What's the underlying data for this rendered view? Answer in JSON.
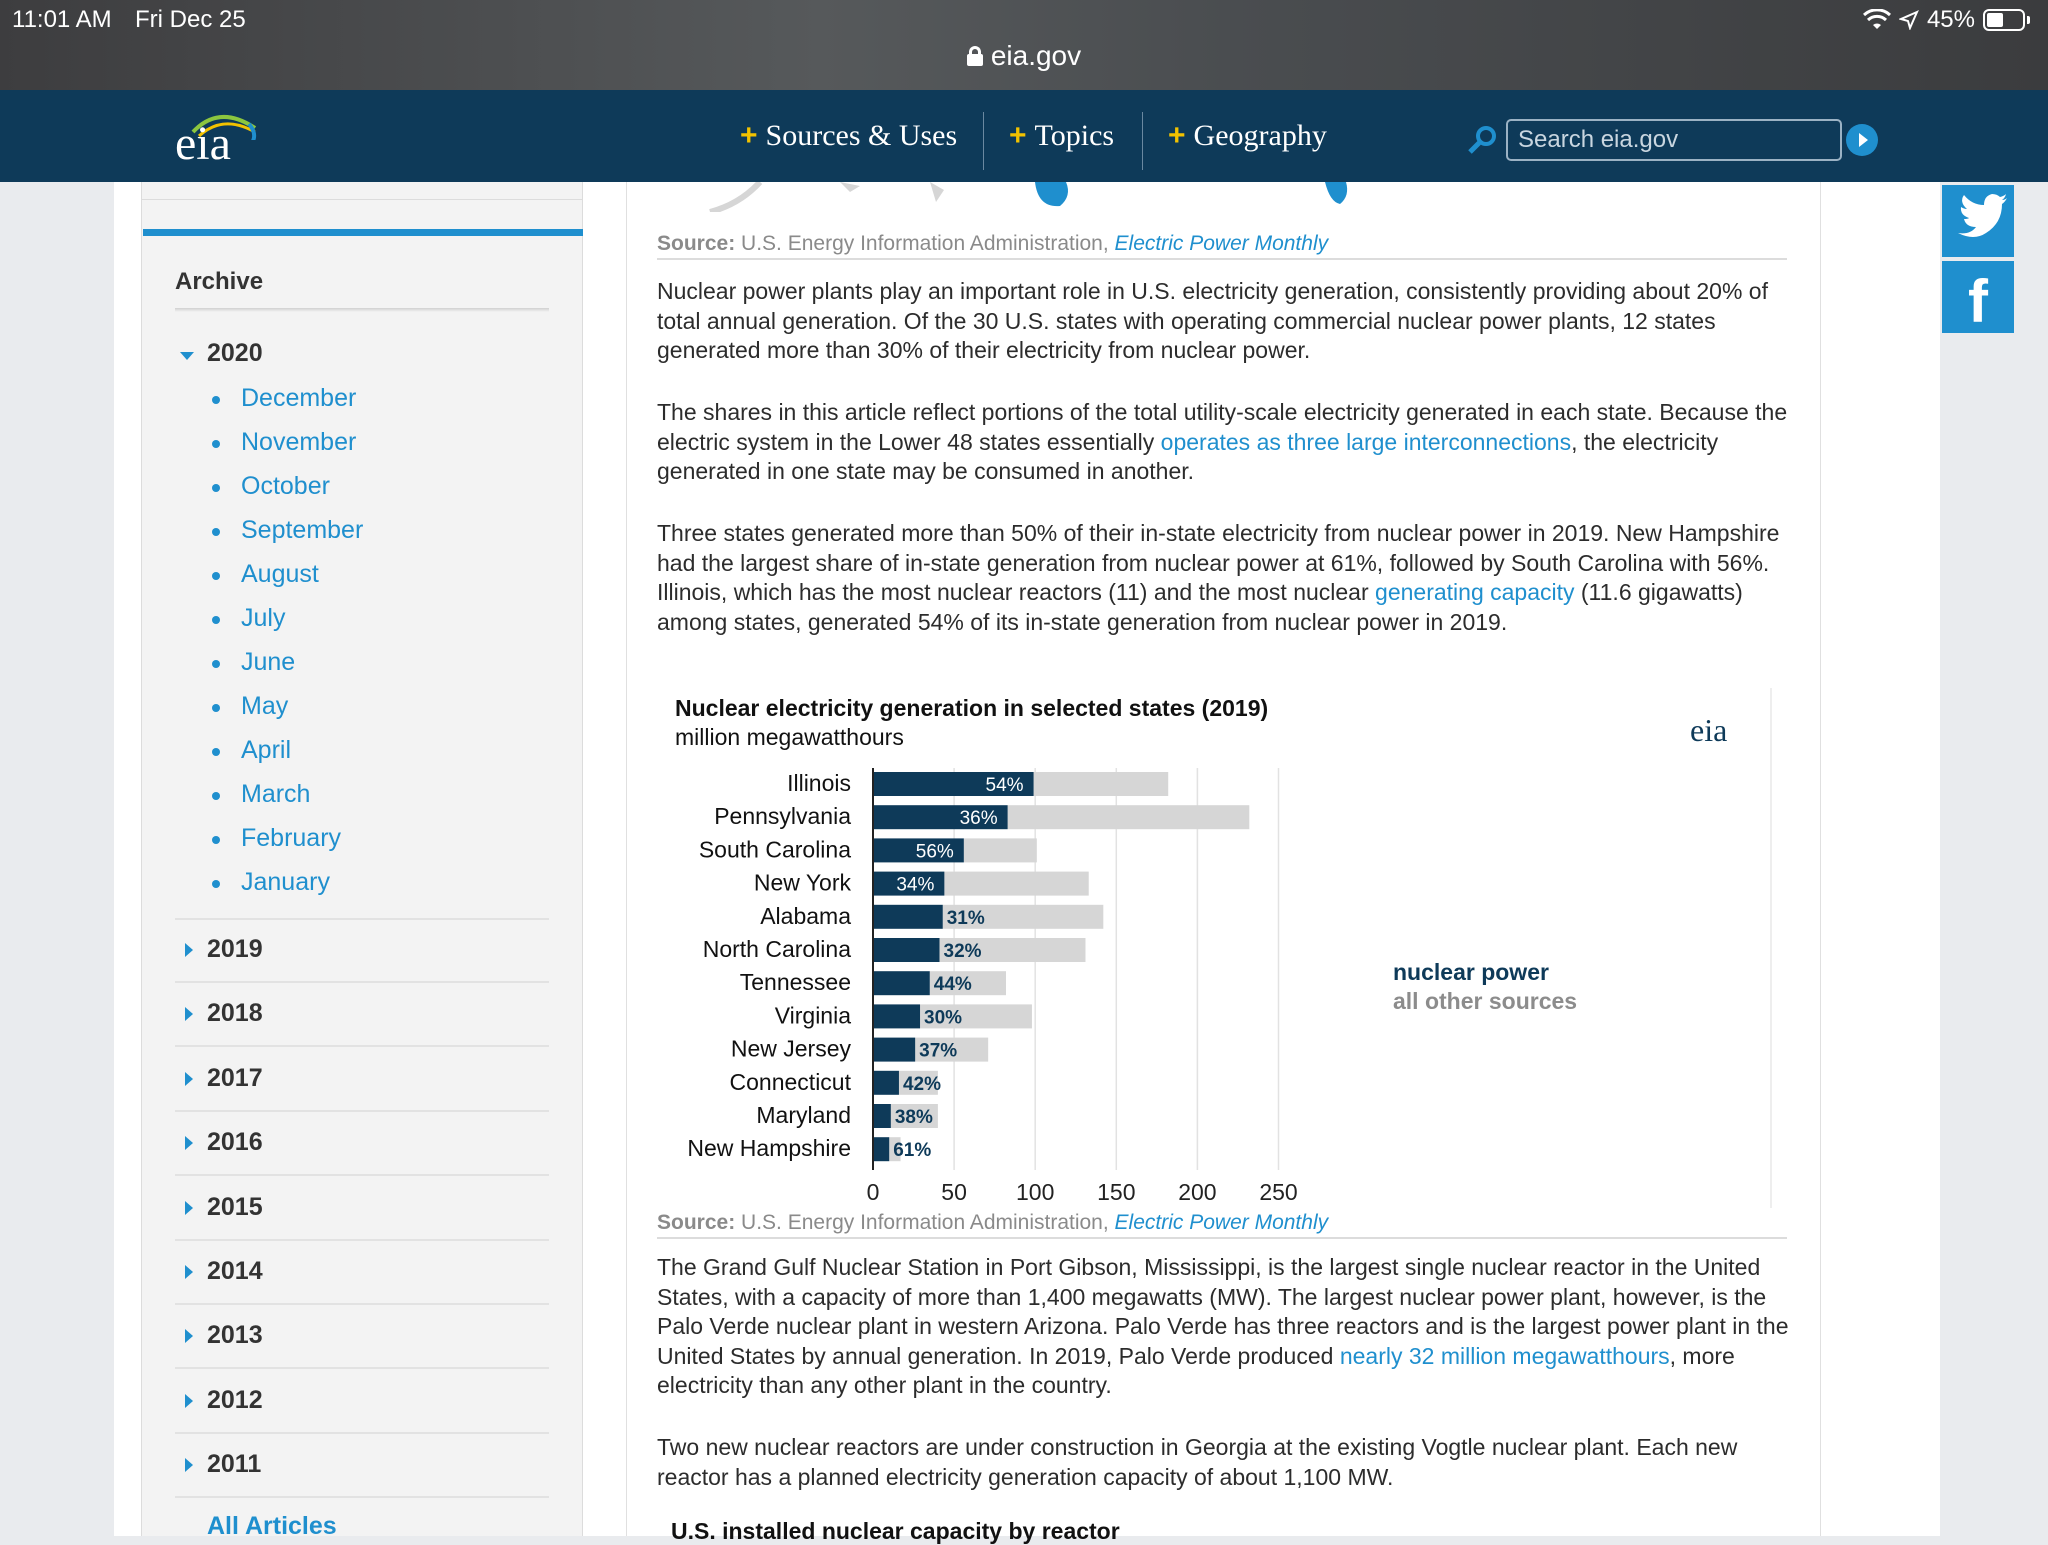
{
  "status": {
    "time": "11:01 AM",
    "date": "Fri Dec 25",
    "battery": "45%"
  },
  "browser": {
    "url": "eia.gov"
  },
  "header": {
    "logo": "eia",
    "nav": [
      "Sources & Uses",
      "Topics",
      "Geography"
    ],
    "search_placeholder": "Search eia.gov"
  },
  "sidebar": {
    "title": "Archive",
    "open_year": "2020",
    "months": [
      "December",
      "November",
      "October",
      "September",
      "August",
      "July",
      "June",
      "May",
      "April",
      "March",
      "February",
      "January"
    ],
    "years": [
      "2019",
      "2018",
      "2017",
      "2016",
      "2015",
      "2014",
      "2013",
      "2012",
      "2011"
    ],
    "all_articles": "All Articles"
  },
  "article": {
    "source1": {
      "label": "Source:",
      "org": "U.S. Energy Information Administration,",
      "link": "Electric Power Monthly"
    },
    "p1": "Nuclear power plants play an important role in U.S. electricity generation, consistently providing about 20% of total annual generation. Of the 30 U.S. states with operating commercial nuclear power plants, 12 states generated more than 30% of their electricity from nuclear power.",
    "p2": {
      "a": "The shares in this article reflect portions of the total utility-scale electricity generated in each state. Because the electric system in the Lower 48 states essentially ",
      "link": "operates as three large interconnections",
      "b": ", the electricity generated in one state may be consumed in another."
    },
    "p3": {
      "a": "Three states generated more than 50% of their in-state electricity from nuclear power in 2019. New Hampshire had the largest share of in-state generation from nuclear power at 61%, followed by South Carolina with 56%. Illinois, which has the most nuclear reactors (11) and the most nuclear ",
      "link": "generating capacity",
      "b": " (11.6 gigawatts) among states, generated 54% of its in-state generation from nuclear power in 2019."
    },
    "source2": {
      "label": "Source:",
      "org": "U.S. Energy Information Administration,",
      "link": "Electric Power Monthly"
    },
    "p4": {
      "a": "The Grand Gulf Nuclear Station in Port Gibson, Mississippi, is the largest single nuclear reactor in the United States, with a capacity of more than 1,400 megawatts (MW). The largest nuclear power plant, however, is the Palo Verde nuclear plant in western Arizona. Palo Verde has three reactors and is the largest power plant in the United States by annual generation. In 2019, Palo Verde produced ",
      "link": "nearly 32 million megawatthours",
      "b": ", more electricity than any other plant in the country."
    },
    "p5": "Two new nuclear reactors are under construction in Georgia at the existing Vogtle nuclear plant. Each new reactor has a planned electricity generation capacity of about 1,100 MW.",
    "next_heading": "U.S. installed nuclear capacity by reactor"
  },
  "chart_data": {
    "type": "bar",
    "orientation": "horizontal",
    "stacked": true,
    "title": "Nuclear electricity generation in selected states (2019)",
    "subtitle": "million megawatthours",
    "logo": "eia",
    "categories": [
      "Illinois",
      "Pennsylvania",
      "South Carolina",
      "New York",
      "Alabama",
      "North Carolina",
      "Tennessee",
      "Virginia",
      "New Jersey",
      "Connecticut",
      "Maryland",
      "New Hampshire"
    ],
    "series": [
      {
        "name": "nuclear power",
        "color": "#0e3a59",
        "values": [
          99,
          83,
          56,
          44,
          43,
          41,
          35,
          29,
          26,
          16,
          11,
          10
        ]
      },
      {
        "name": "all other sources",
        "color": "#d6d6d6",
        "values": [
          83,
          149,
          45,
          89,
          99,
          90,
          47,
          69,
          45,
          24,
          29,
          7
        ]
      }
    ],
    "labels": [
      "54%",
      "36%",
      "56%",
      "34%",
      "31%",
      "32%",
      "44%",
      "30%",
      "37%",
      "42%",
      "38%",
      "61%"
    ],
    "xlim": [
      0,
      250
    ],
    "xticks": [
      0,
      50,
      100,
      150,
      200,
      250
    ],
    "legend_position": "right"
  }
}
